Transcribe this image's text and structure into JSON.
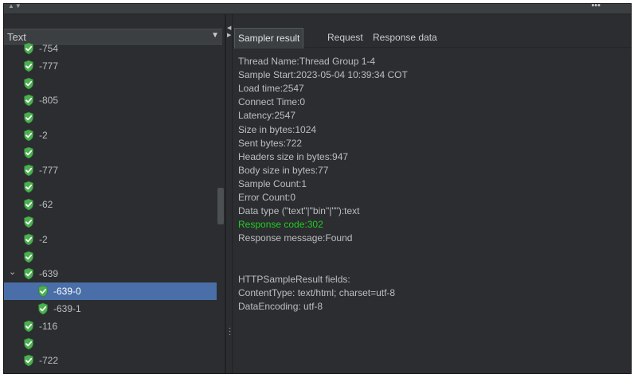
{
  "topbar": {
    "collapse_arrows": "▲▼",
    "more_dots": "•••"
  },
  "left": {
    "renderer_select": {
      "value": "Text",
      "arrow": "▼"
    },
    "tree": [
      {
        "label": "-754",
        "level": 0
      },
      {
        "label": "-777",
        "level": 0
      },
      {
        "label": "",
        "level": 0
      },
      {
        "label": "-805",
        "level": 0
      },
      {
        "label": "",
        "level": 0
      },
      {
        "label": "-2",
        "level": 0
      },
      {
        "label": "",
        "level": 0
      },
      {
        "label": "-777",
        "level": 0
      },
      {
        "label": "",
        "level": 0
      },
      {
        "label": "-62",
        "level": 0
      },
      {
        "label": "",
        "level": 0
      },
      {
        "label": "-2",
        "level": 0
      },
      {
        "label": "",
        "level": 0
      },
      {
        "label": "-639",
        "level": 0,
        "expanded": true
      },
      {
        "label": "-639-0",
        "level": 1,
        "selected": true
      },
      {
        "label": "-639-1",
        "level": 1
      },
      {
        "label": "-116",
        "level": 0
      },
      {
        "label": "",
        "level": 0
      },
      {
        "label": "-722",
        "level": 0
      }
    ]
  },
  "right": {
    "tabs": [
      "Sampler result",
      "Request",
      "Response data"
    ],
    "active_tab": "Sampler result",
    "lines": [
      {
        "text": "Thread Name:Thread Group 1-4"
      },
      {
        "text": "Sample Start:2023-05-04 10:39:34 COT"
      },
      {
        "text": "Load time:2547"
      },
      {
        "text": "Connect Time:0"
      },
      {
        "text": "Latency:2547"
      },
      {
        "text": "Size in bytes:1024"
      },
      {
        "text": "Sent bytes:722"
      },
      {
        "text": "Headers size in bytes:947"
      },
      {
        "text": "Body size in bytes:77"
      },
      {
        "text": "Sample Count:1"
      },
      {
        "text": "Error Count:0"
      },
      {
        "text": "Data type (\"text\"|\"bin\"|\"\"):text"
      },
      {
        "text": "Response code:302",
        "highlight": true
      },
      {
        "text": "Response message:Found"
      },
      {
        "text": ""
      },
      {
        "text": ""
      },
      {
        "text": "HTTPSampleResult fields:"
      },
      {
        "text": "ContentType: text/html; charset=utf-8"
      },
      {
        "text": "DataEncoding: utf-8"
      }
    ]
  },
  "colors": {
    "success_icon": "#4caf50",
    "selection": "#4a6fa8",
    "response_code": "#22cc22",
    "panel_bg": "#2b2d30"
  },
  "icons": {
    "sample_status": "check-shield-icon"
  }
}
